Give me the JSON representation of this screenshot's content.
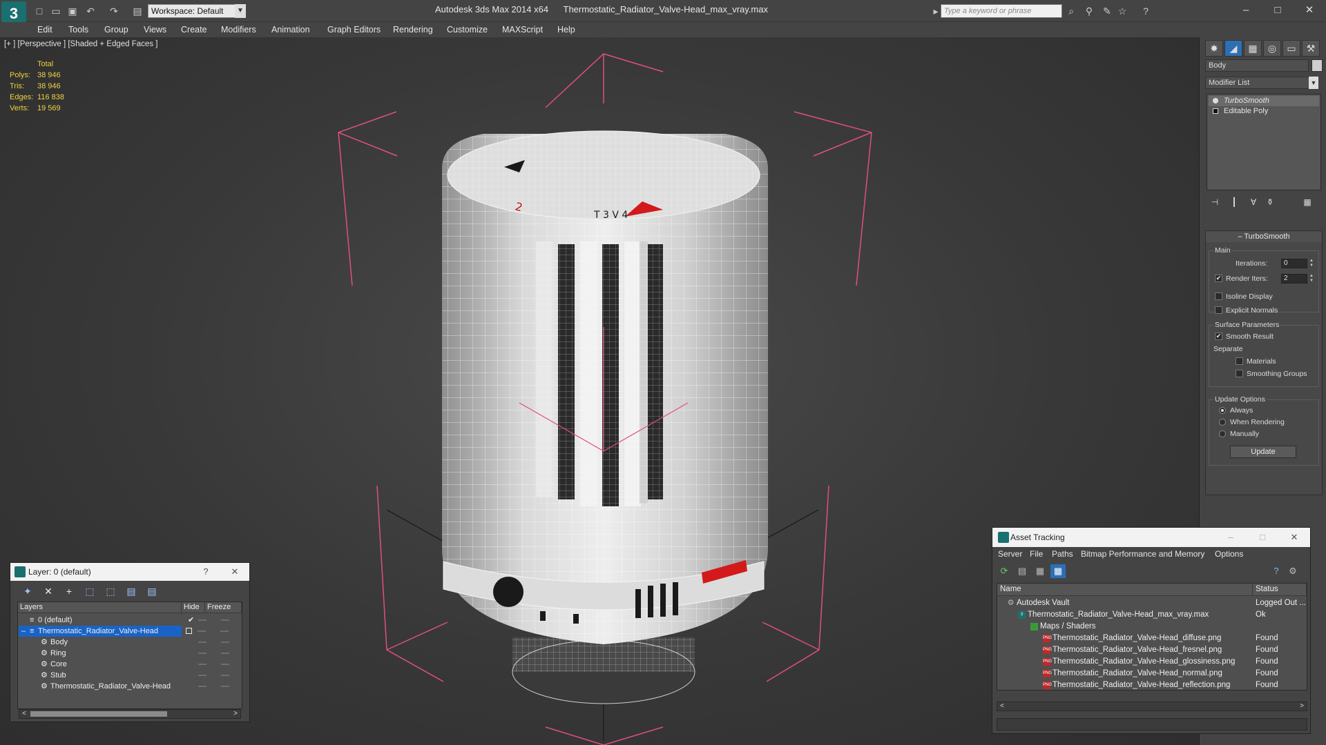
{
  "titlebar": {
    "workspace": "Workspace: Default",
    "app_name": "Autodesk 3ds Max  2014 x64",
    "file_name": "Thermostatic_Radiator_Valve-Head_max_vray.max",
    "search_placeholder": "Type a keyword or phrase"
  },
  "menu": [
    "Edit",
    "Tools",
    "Group",
    "Views",
    "Create",
    "Modifiers",
    "Animation",
    "Graph Editors",
    "Rendering",
    "Customize",
    "MAXScript",
    "Help"
  ],
  "viewport": {
    "label": "[+ ] [Perspective ] [Shaded + Edged Faces ]",
    "stats_header": "Total",
    "stats": [
      {
        "label": "Polys:",
        "value": "38 946"
      },
      {
        "label": "Tris:",
        "value": "38 946"
      },
      {
        "label": "Edges:",
        "value": "116 838"
      },
      {
        "label": "Verts:",
        "value": "19 569"
      }
    ]
  },
  "command_panel": {
    "object_name": "Body",
    "modifier_list": "Modifier List",
    "stack": [
      "TurboSmooth",
      "Editable Poly"
    ],
    "rollout_title": "TurboSmooth",
    "main_group": "Main",
    "iterations_label": "Iterations:",
    "iterations_value": "0",
    "render_iters_label": "Render Iters:",
    "render_iters_value": "2",
    "isoline": "Isoline Display",
    "explicit_normals": "Explicit Normals",
    "surface_group": "Surface Parameters",
    "smooth_result": "Smooth Result",
    "separate": "Separate",
    "materials": "Materials",
    "smoothing_groups": "Smoothing Groups",
    "update_group": "Update Options",
    "always": "Always",
    "when_rendering": "When Rendering",
    "manually": "Manually",
    "update_button": "Update"
  },
  "layer_dialog": {
    "title": "Layer: 0 (default)",
    "help": "?",
    "close": "✕",
    "columns": [
      "Layers",
      "Hide",
      "Freeze"
    ],
    "rows": [
      {
        "name": "0 (default)",
        "level": 1,
        "selected": false
      },
      {
        "name": "Thermostatic_Radiator_Valve-Head",
        "level": 1,
        "selected": true
      },
      {
        "name": "Body",
        "level": 2,
        "selected": false
      },
      {
        "name": "Ring",
        "level": 2,
        "selected": false
      },
      {
        "name": "Core",
        "level": 2,
        "selected": false
      },
      {
        "name": "Stub",
        "level": 2,
        "selected": false
      },
      {
        "name": "Thermostatic_Radiator_Valve-Head",
        "level": 2,
        "selected": false
      }
    ]
  },
  "asset_dialog": {
    "title": "Asset Tracking",
    "menu": [
      "Server",
      "File",
      "Paths",
      "Bitmap Performance and Memory",
      "Options"
    ],
    "columns": [
      "Name",
      "Status"
    ],
    "rows": [
      {
        "name": "Autodesk Vault",
        "status": "Logged Out ...",
        "level": 1
      },
      {
        "name": "Thermostatic_Radiator_Valve-Head_max_vray.max",
        "status": "Ok",
        "level": 2
      },
      {
        "name": "Maps / Shaders",
        "status": "",
        "level": 3
      },
      {
        "name": "Thermostatic_Radiator_Valve-Head_diffuse.png",
        "status": "Found",
        "level": 4
      },
      {
        "name": "Thermostatic_Radiator_Valve-Head_fresnel.png",
        "status": "Found",
        "level": 4
      },
      {
        "name": "Thermostatic_Radiator_Valve-Head_glossiness.png",
        "status": "Found",
        "level": 4
      },
      {
        "name": "Thermostatic_Radiator_Valve-Head_normal.png",
        "status": "Found",
        "level": 4
      },
      {
        "name": "Thermostatic_Radiator_Valve-Head_reflection.png",
        "status": "Found",
        "level": 4
      }
    ]
  },
  "colors": {
    "stats_yellow": "#f0d23c",
    "selection_blue": "#1a63c6",
    "gizmo_pink": "#e0507a"
  }
}
